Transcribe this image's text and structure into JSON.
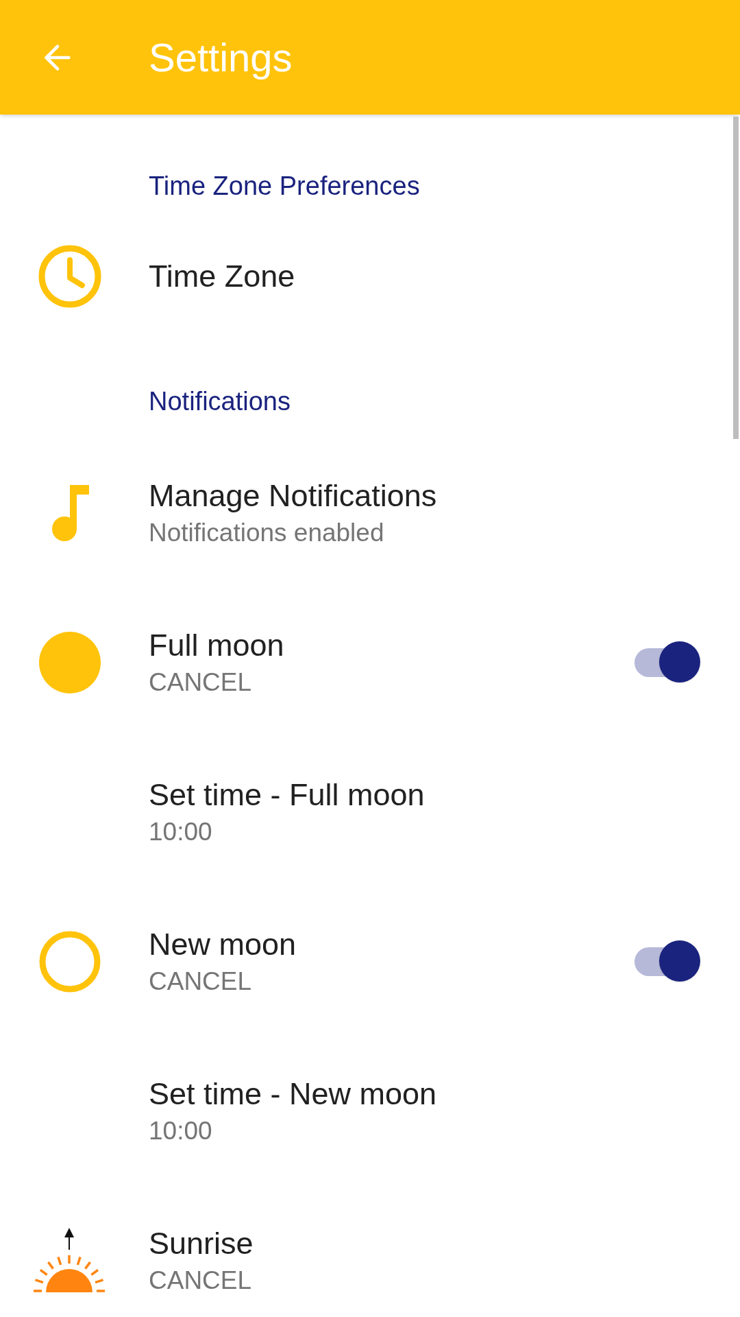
{
  "app_bar": {
    "title": "Settings"
  },
  "sections": [
    {
      "title": "Time Zone Preferences",
      "items": [
        {
          "kind": "clock",
          "title": "Time Zone"
        }
      ]
    },
    {
      "title": "Notifications",
      "items": [
        {
          "kind": "note",
          "title": "Manage Notifications",
          "subtitle": "Notifications enabled"
        },
        {
          "kind": "full_moon",
          "title": "Full moon",
          "subtitle": "CANCEL",
          "on": true
        },
        {
          "kind": "plain",
          "title": "Set time - Full moon",
          "subtitle": "10:00"
        },
        {
          "kind": "new_moon",
          "title": "New moon",
          "subtitle": "CANCEL",
          "on": true
        },
        {
          "kind": "plain",
          "title": "Set time - New moon",
          "subtitle": "10:00"
        },
        {
          "kind": "sunrise",
          "title": "Sunrise",
          "subtitle": "CANCEL"
        }
      ]
    }
  ]
}
